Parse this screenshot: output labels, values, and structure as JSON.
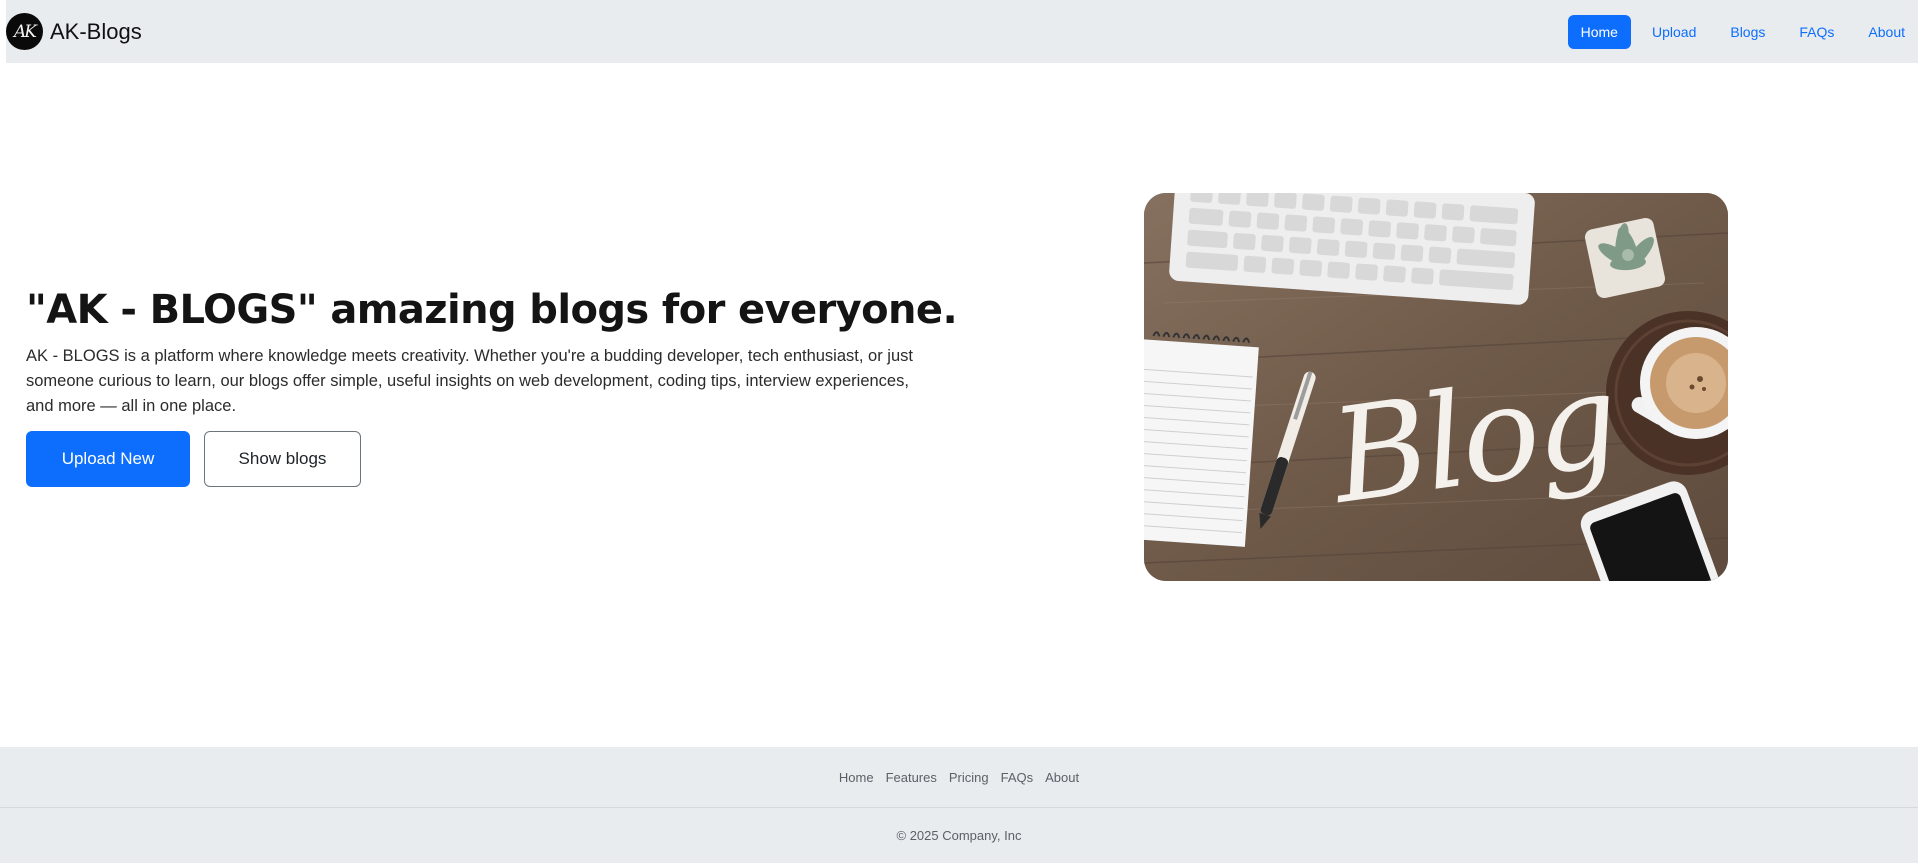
{
  "navbar": {
    "brand_logo_text": "AK",
    "brand_name": "AK-Blogs",
    "links": [
      {
        "label": "Home",
        "active": true
      },
      {
        "label": "Upload",
        "active": false
      },
      {
        "label": "Blogs",
        "active": false
      },
      {
        "label": "FAQs",
        "active": false
      },
      {
        "label": "About",
        "active": false
      }
    ]
  },
  "hero": {
    "title": "\"AK - BLOGS\" amazing blogs for everyone.",
    "description": "AK - BLOGS is a platform where knowledge meets creativity. Whether you're a budding developer, tech enthusiast, or just someone curious to learn, our blogs offer simple, useful insights on web development, coding tips, interview experiences, and more — all in one place.",
    "primary_button": "Upload New",
    "secondary_button": "Show blogs",
    "image_text": "Blog"
  },
  "footer": {
    "links": [
      "Home",
      "Features",
      "Pricing",
      "FAQs",
      "About"
    ],
    "copyright": "© 2025 Company, Inc"
  },
  "colors": {
    "primary": "#0d6efd",
    "navbar_bg": "#e9ecef",
    "footer_bg": "#e9ecef",
    "text": "#212529"
  }
}
